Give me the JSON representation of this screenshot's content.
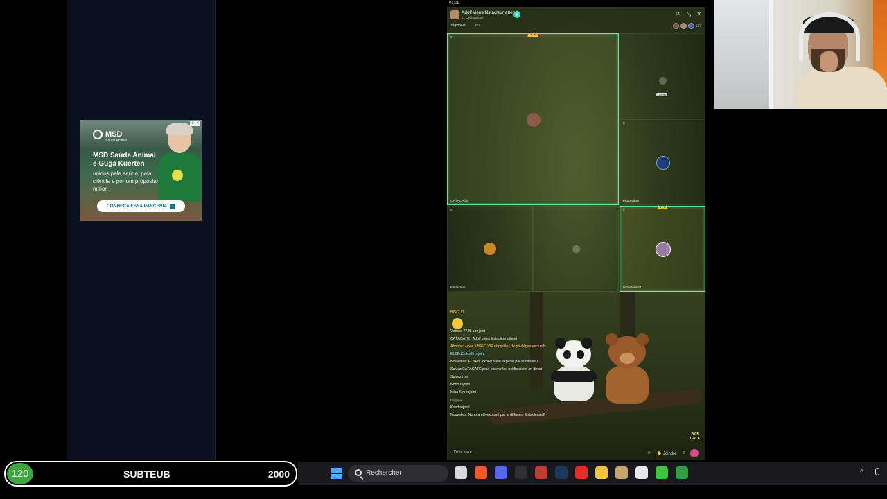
{
  "clock": "01:09",
  "ad": {
    "brand": "MSD",
    "brand_sub": "Saúde Animal",
    "title": "MSD Saúde Animal e Guga Kuerten",
    "text": "unidos pela saúde, pela ciência e por um propósito maior.",
    "button_label": "CONHEÇA ESSA PARCERIA"
  },
  "stream": {
    "title": "Adolf viens filstacleur attend",
    "subtitle": "21 Célébrations",
    "tags": [
      "régionale",
      "0/1"
    ],
    "viewer_count": "137",
    "seats": [
      {
        "name": "CAŤACAŤE",
        "score": "0"
      },
      {
        "name": "",
        "score": "",
        "tip": "Libérer"
      },
      {
        "name": "Pitou-piłou",
        "score": "0"
      },
      {
        "name": "Filstacleur",
        "score": "0"
      },
      {
        "name": "",
        "score": ""
      },
      {
        "name": "filstacleuse2",
        "score": "0"
      }
    ],
    "chat": [
      {
        "text": "BISCUIT",
        "cls": "hl2"
      },
      {
        "text": "Visiteur 7745 a rejoint",
        "cls": ""
      },
      {
        "text": "CAŤACAŤE : Adolf viens filstacleur attend",
        "cls": ""
      },
      {
        "text": "Abonnez-vous à BIGO VIP et profitez de privilèges exclusifs",
        "cls": "hl2"
      },
      {
        "text": "ELBEdOcko69 rejoint",
        "cls": "hl"
      },
      {
        "text": "Nouvelles: ELBEdOcko69 a été expulsé par le diffuseur",
        "cls": ""
      },
      {
        "text": "Suivez CAŤACAŤE pour obtenir les notifications en direct",
        "cls": ""
      },
      {
        "text": "Suivez-moi",
        "cls": ""
      },
      {
        "text": "Nono rejoint",
        "cls": ""
      },
      {
        "text": "Mika Kim rejoint",
        "cls": ""
      },
      {
        "text": "Belgique",
        "cls": "sub"
      },
      {
        "text": "Kund rejoint",
        "cls": ""
      },
      {
        "text": "Nouvelles: Nono a été expulsé par le diffuseur filstacleuse2",
        "cls": ""
      }
    ],
    "input_placeholder": "Dites salut...",
    "join_label": "Joindre",
    "gala_line1": "2025",
    "gala_line2": "GALA"
  },
  "subwidget": {
    "count": "120",
    "label": "SUBTEUB",
    "goal": "2000"
  },
  "taskbar": {
    "search_label": "Rechercher",
    "apps": [
      {
        "name": "task-view-icon",
        "color": "#d8d8d8"
      },
      {
        "name": "brave-icon",
        "color": "#f05a28"
      },
      {
        "name": "discord-icon",
        "color": "#5865f2"
      },
      {
        "name": "obs-icon",
        "color": "#303030"
      },
      {
        "name": "chrome-icon",
        "color": "#c23b32"
      },
      {
        "name": "steam-icon",
        "color": "#1b3a5a"
      },
      {
        "name": "youtube-icon",
        "color": "#e52d27"
      },
      {
        "name": "folder-icon",
        "color": "#f3c13a"
      },
      {
        "name": "app-icon",
        "color": "#c9a46a"
      },
      {
        "name": "notes-icon",
        "color": "#e8e8e8"
      },
      {
        "name": "green-app-icon",
        "color": "#3ec43e"
      },
      {
        "name": "brazil-icon",
        "color": "#2f9e44"
      }
    ]
  }
}
